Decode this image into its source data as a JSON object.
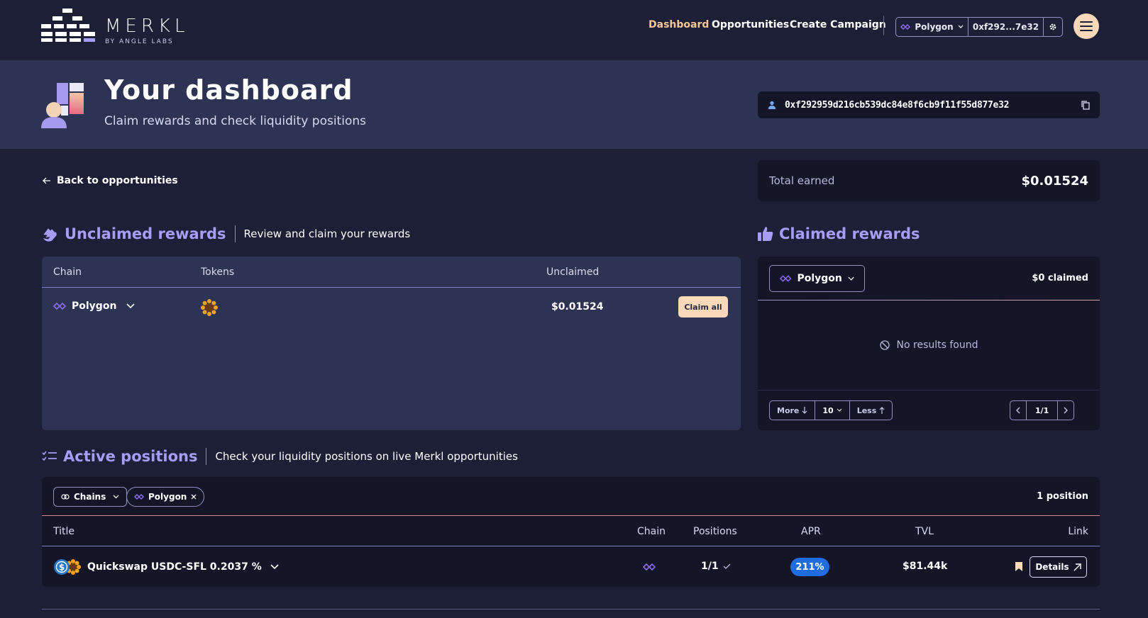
{
  "brand": {
    "name": "MERKL",
    "sub": "BY ANGLE LABS"
  },
  "nav": {
    "dashboard": "Dashboard",
    "opportunities": "Opportunities",
    "create_campaign": "Create Campaign"
  },
  "wallet": {
    "chain": "Polygon",
    "short_address": "0xf292...7e32"
  },
  "hero": {
    "title": "Your dashboard",
    "subtitle": "Claim rewards and check liquidity positions",
    "address": "0xf292959d216cb539dc84e8f6cb9f11f55d877e32"
  },
  "back_link": "Back to opportunities",
  "total": {
    "label": "Total earned",
    "value": "$0.01524"
  },
  "unclaimed": {
    "title": "Unclaimed rewards",
    "description": "Review and claim your rewards",
    "columns": {
      "chain": "Chain",
      "tokens": "Tokens",
      "unclaimed": "Unclaimed"
    },
    "row": {
      "chain": "Polygon",
      "amount": "$0.01524",
      "claim_label": "Claim all"
    }
  },
  "claimed": {
    "title": "Claimed rewards",
    "chain": "Polygon",
    "summary": "$0 claimed",
    "empty": "No results found",
    "pager": {
      "more": "More",
      "size": "10",
      "less": "Less",
      "page": "1/1"
    }
  },
  "active": {
    "title": "Active positions",
    "description": "Check your liquidity positions on live Merkl opportunities",
    "filters": {
      "chains": "Chains",
      "chip": "Polygon"
    },
    "count": "1 position",
    "columns": {
      "title": "Title",
      "chain": "Chain",
      "positions": "Positions",
      "apr": "APR",
      "tvl": "TVL",
      "link": "Link"
    },
    "row": {
      "title": "Quickswap USDC-SFL 0.2037 %",
      "positions": "1/1",
      "apr": "211%",
      "tvl": "$81.44k",
      "details": "Details"
    }
  },
  "colors": {
    "accent": "#a79cf7",
    "peach": "#f9d9b9",
    "apr_badge": "#1f6de0",
    "bg": "#1c1f36",
    "card": "#141628",
    "panel": "#2d3352"
  }
}
